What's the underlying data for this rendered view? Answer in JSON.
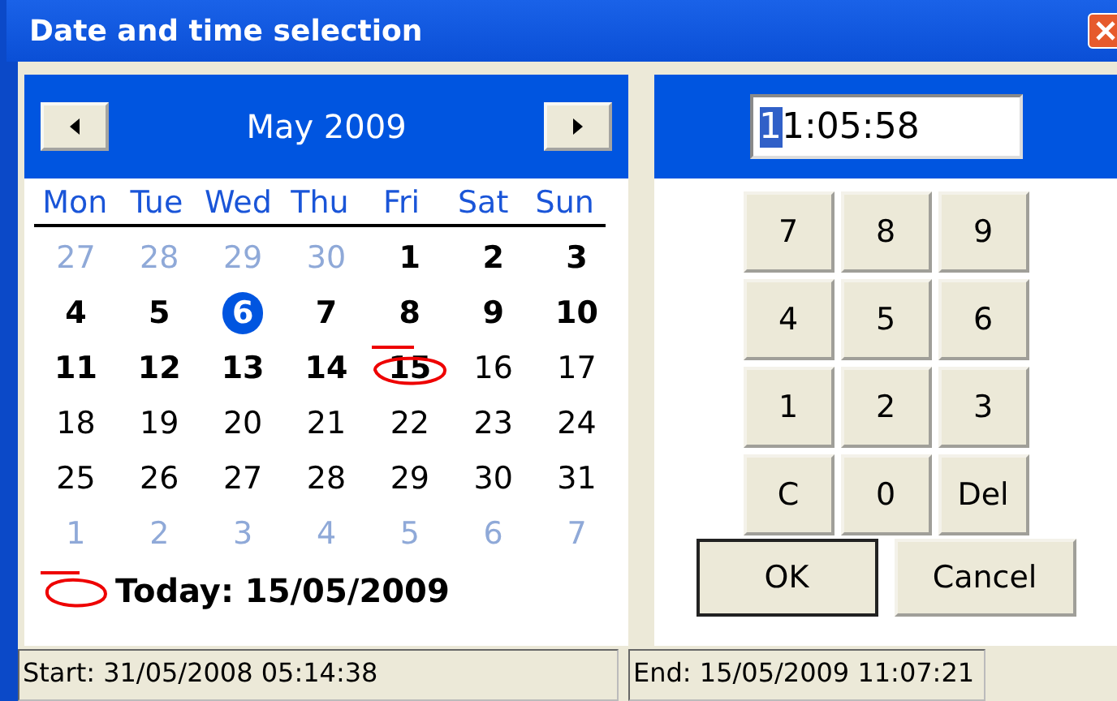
{
  "window": {
    "title": "Date and time selection"
  },
  "calendar": {
    "month": "May 2009",
    "weekdays": [
      "Mon",
      "Tue",
      "Wed",
      "Thu",
      "Fri",
      "Sat",
      "Sun"
    ],
    "days": [
      {
        "day": "27",
        "kind": "outside",
        "selected": false,
        "today": false
      },
      {
        "day": "28",
        "kind": "outside",
        "selected": false,
        "today": false
      },
      {
        "day": "29",
        "kind": "outside",
        "selected": false,
        "today": false
      },
      {
        "day": "30",
        "kind": "outside",
        "selected": false,
        "today": false
      },
      {
        "day": "1",
        "kind": "past",
        "selected": false,
        "today": false
      },
      {
        "day": "2",
        "kind": "past",
        "selected": false,
        "today": false
      },
      {
        "day": "3",
        "kind": "past",
        "selected": false,
        "today": false
      },
      {
        "day": "4",
        "kind": "past",
        "selected": false,
        "today": false
      },
      {
        "day": "5",
        "kind": "past",
        "selected": false,
        "today": false
      },
      {
        "day": "6",
        "kind": "past",
        "selected": true,
        "today": false
      },
      {
        "day": "7",
        "kind": "past",
        "selected": false,
        "today": false
      },
      {
        "day": "8",
        "kind": "past",
        "selected": false,
        "today": false
      },
      {
        "day": "9",
        "kind": "past",
        "selected": false,
        "today": false
      },
      {
        "day": "10",
        "kind": "past",
        "selected": false,
        "today": false
      },
      {
        "day": "11",
        "kind": "past",
        "selected": false,
        "today": false
      },
      {
        "day": "12",
        "kind": "past",
        "selected": false,
        "today": false
      },
      {
        "day": "13",
        "kind": "past",
        "selected": false,
        "today": false
      },
      {
        "day": "14",
        "kind": "past",
        "selected": false,
        "today": false
      },
      {
        "day": "15",
        "kind": "past",
        "selected": false,
        "today": true
      },
      {
        "day": "16",
        "kind": "future",
        "selected": false,
        "today": false
      },
      {
        "day": "17",
        "kind": "future",
        "selected": false,
        "today": false
      },
      {
        "day": "18",
        "kind": "future",
        "selected": false,
        "today": false
      },
      {
        "day": "19",
        "kind": "future",
        "selected": false,
        "today": false
      },
      {
        "day": "20",
        "kind": "future",
        "selected": false,
        "today": false
      },
      {
        "day": "21",
        "kind": "future",
        "selected": false,
        "today": false
      },
      {
        "day": "22",
        "kind": "future",
        "selected": false,
        "today": false
      },
      {
        "day": "23",
        "kind": "future",
        "selected": false,
        "today": false
      },
      {
        "day": "24",
        "kind": "future",
        "selected": false,
        "today": false
      },
      {
        "day": "25",
        "kind": "future",
        "selected": false,
        "today": false
      },
      {
        "day": "26",
        "kind": "future",
        "selected": false,
        "today": false
      },
      {
        "day": "27",
        "kind": "future",
        "selected": false,
        "today": false
      },
      {
        "day": "28",
        "kind": "future",
        "selected": false,
        "today": false
      },
      {
        "day": "29",
        "kind": "future",
        "selected": false,
        "today": false
      },
      {
        "day": "30",
        "kind": "future",
        "selected": false,
        "today": false
      },
      {
        "day": "31",
        "kind": "future",
        "selected": false,
        "today": false
      },
      {
        "day": "1",
        "kind": "outside",
        "selected": false,
        "today": false
      },
      {
        "day": "2",
        "kind": "outside",
        "selected": false,
        "today": false
      },
      {
        "day": "3",
        "kind": "outside",
        "selected": false,
        "today": false
      },
      {
        "day": "4",
        "kind": "outside",
        "selected": false,
        "today": false
      },
      {
        "day": "5",
        "kind": "outside",
        "selected": false,
        "today": false
      },
      {
        "day": "6",
        "kind": "outside",
        "selected": false,
        "today": false
      },
      {
        "day": "7",
        "kind": "outside",
        "selected": false,
        "today": false
      }
    ],
    "today_label": "Today: 15/05/2009"
  },
  "time": {
    "value": "11:05:58"
  },
  "keypad": [
    "7",
    "8",
    "9",
    "4",
    "5",
    "6",
    "1",
    "2",
    "3",
    "C",
    "0",
    "Del"
  ],
  "buttons": [
    {
      "label": "OK",
      "default": true
    },
    {
      "label": "Cancel",
      "default": false
    }
  ],
  "status_bar": [
    "Start: 31/05/2008 05:14:38",
    "End: 15/05/2009 11:07:21"
  ]
}
